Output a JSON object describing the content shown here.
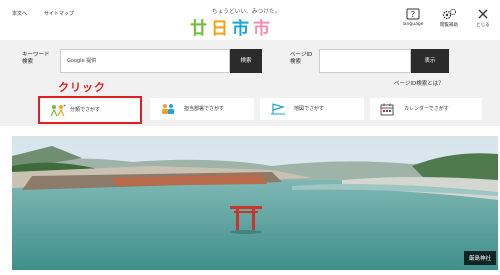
{
  "header": {
    "links": [
      "本文へ",
      "サイトマップ"
    ],
    "tagline": "ちょうどいい、みつけた。",
    "logo_chars": [
      "廿",
      "日",
      "市",
      "市"
    ],
    "utilities": [
      {
        "label": "language",
        "icon": "question-box-icon"
      },
      {
        "label": "閲覧補助",
        "icon": "gears-icon"
      },
      {
        "label": "とじる",
        "icon": "close-icon"
      }
    ]
  },
  "search": {
    "keyword_label": "キーワード\n検索",
    "keyword_placeholder": "Google 提供",
    "keyword_button": "検索",
    "pageid_label": "ページID\n検索",
    "pageid_button": "表示",
    "pageid_help": "ページID検索とは？"
  },
  "annotation": {
    "text": "クリック",
    "color": "#e02020"
  },
  "nav_buttons": [
    {
      "label": "分類でさがす",
      "icon": "people-category-icon",
      "highlighted": true
    },
    {
      "label": "担当部署でさがす",
      "icon": "staff-icon",
      "highlighted": false
    },
    {
      "label": "地図でさがす",
      "icon": "map-flag-icon",
      "highlighted": false
    },
    {
      "label": "カレンダーでさがす",
      "icon": "calendar-icon",
      "highlighted": false
    }
  ],
  "hero": {
    "caption": "厳島神社"
  },
  "colors": {
    "accent_red": "#e02020",
    "panel_bg": "#f1f1f1",
    "dark_button": "#2b2b2b"
  }
}
